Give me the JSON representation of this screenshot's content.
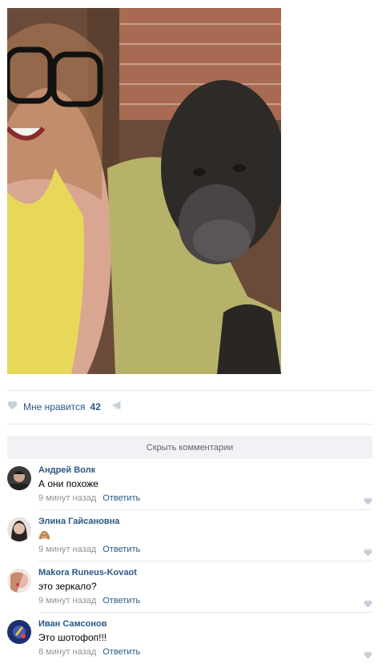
{
  "post": {
    "like_label": "Мне нравится",
    "like_count": "42"
  },
  "comments_toggle": "Скрыть комментарии",
  "comments": [
    {
      "author": "Андрей Волк",
      "text": "А они похоже",
      "time": "9 минут назад",
      "reply": "Ответить"
    },
    {
      "author": "Элина Гайсановна",
      "text": "🙈",
      "time": "9 минут назад",
      "reply": "Ответить"
    },
    {
      "author": "Makora Runeus-Kovaot",
      "text": "это зеркало?",
      "time": "9 минут назад",
      "reply": "Ответить"
    },
    {
      "author": "Иван Самсонов",
      "text": "Это шотофоп!!!",
      "time": "8 минут назад",
      "reply": "Ответить"
    }
  ],
  "colors": {
    "link": "#2a5885",
    "meta": "#939393",
    "icon": "#c5d0db",
    "divider": "#e7e8ec"
  }
}
